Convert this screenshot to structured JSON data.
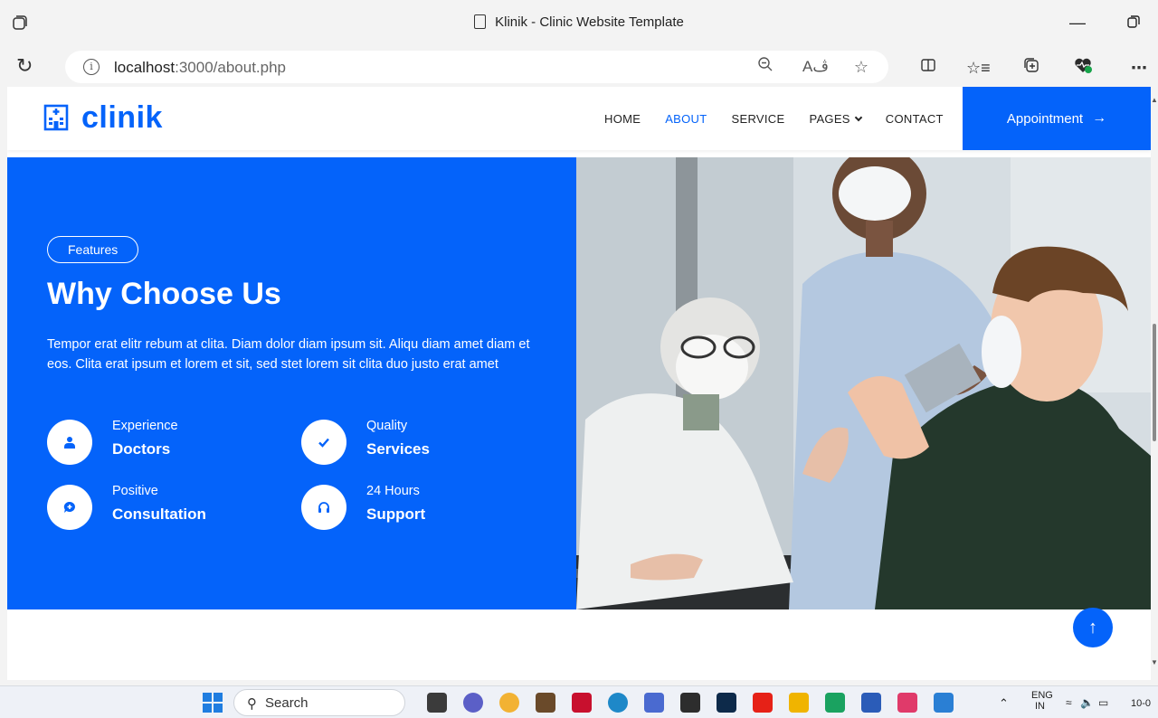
{
  "browser": {
    "window_title": "Klinik - Clinic Website Template",
    "url_host": "localhost",
    "url_rest": ":3000/about.php"
  },
  "site": {
    "brand": "clinik",
    "nav": {
      "home": "HOME",
      "about": "ABOUT",
      "service": "SERVICE",
      "pages": "PAGES",
      "contact": "CONTACT"
    },
    "appointment_label": "Appointment",
    "colors": {
      "primary": "#0463fa",
      "white": "#ffffff"
    }
  },
  "hero": {
    "badge": "Features",
    "title": "Why Choose Us",
    "description": "Tempor erat elitr rebum at clita. Diam dolor diam ipsum sit. Aliqu diam amet diam et eos. Clita erat ipsum et lorem et sit, sed stet lorem sit clita duo justo erat amet",
    "features": [
      {
        "small": "Experience",
        "big": "Doctors",
        "icon": "doctor-icon"
      },
      {
        "small": "Quality",
        "big": "Services",
        "icon": "check-icon"
      },
      {
        "small": "Positive",
        "big": "Consultation",
        "icon": "comment-icon"
      },
      {
        "small": "24 Hours",
        "big": "Support",
        "icon": "headphones-icon"
      }
    ]
  },
  "taskbar": {
    "search_label": "Search",
    "lang_top": "ENG",
    "lang_bottom": "IN",
    "clock": "10-0"
  }
}
